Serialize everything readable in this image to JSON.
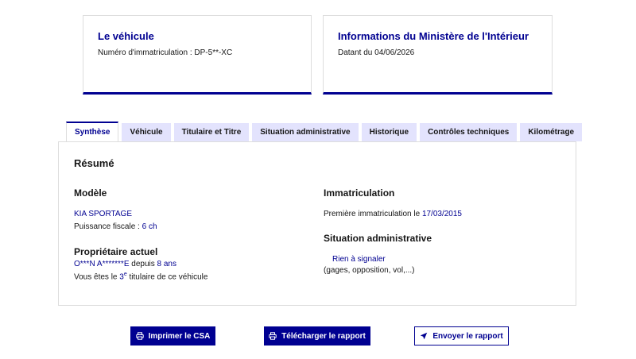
{
  "cards": {
    "vehicle": {
      "title": "Le véhicule",
      "registration_label": "Numéro d'immatriculation : ",
      "registration_value": "DP-5**-XC"
    },
    "ministry": {
      "title": "Informations du Ministère de l'Intérieur",
      "date_label": "Datant du ",
      "date_value": "04/06/2026"
    }
  },
  "tabs": [
    {
      "label": "Synthèse",
      "active": true
    },
    {
      "label": "Véhicule",
      "active": false
    },
    {
      "label": "Titulaire et Titre",
      "active": false
    },
    {
      "label": "Situation administrative",
      "active": false
    },
    {
      "label": "Historique",
      "active": false
    },
    {
      "label": "Contrôles techniques",
      "active": false
    },
    {
      "label": "Kilométrage",
      "active": false
    }
  ],
  "summary": {
    "title": "Résumé",
    "model": {
      "heading": "Modèle",
      "name": "KIA SPORTAGE",
      "fiscal_power_label": "Puissance fiscale : ",
      "fiscal_power_value": "6 ch"
    },
    "owner": {
      "heading": "Propriétaire actuel",
      "name": "O***N A*******E",
      "since_label": " depuis ",
      "since_value": "8 ans",
      "rank_prefix": "Vous êtes le ",
      "rank_number": "3",
      "rank_suffix": "e",
      "rank_rest": " titulaire de ce véhicule"
    },
    "registration": {
      "heading": "Immatriculation",
      "first_label": "Première immatriculation le ",
      "first_date": "17/03/2015"
    },
    "admin_status": {
      "heading": "Situation administrative",
      "status": "Rien à signaler",
      "details": "(gages, opposition, vol,...)"
    }
  },
  "actions": {
    "print": {
      "label": "Imprimer le CSA",
      "icon": "printer-icon"
    },
    "download": {
      "label": "Télécharger le rapport",
      "icon": "printer-icon"
    },
    "send": {
      "label": "Envoyer le rapport",
      "icon": "send-icon"
    }
  },
  "colors": {
    "primary": "#000091",
    "tab_inactive_bg": "#e3e3fd",
    "border": "#dddddd"
  }
}
